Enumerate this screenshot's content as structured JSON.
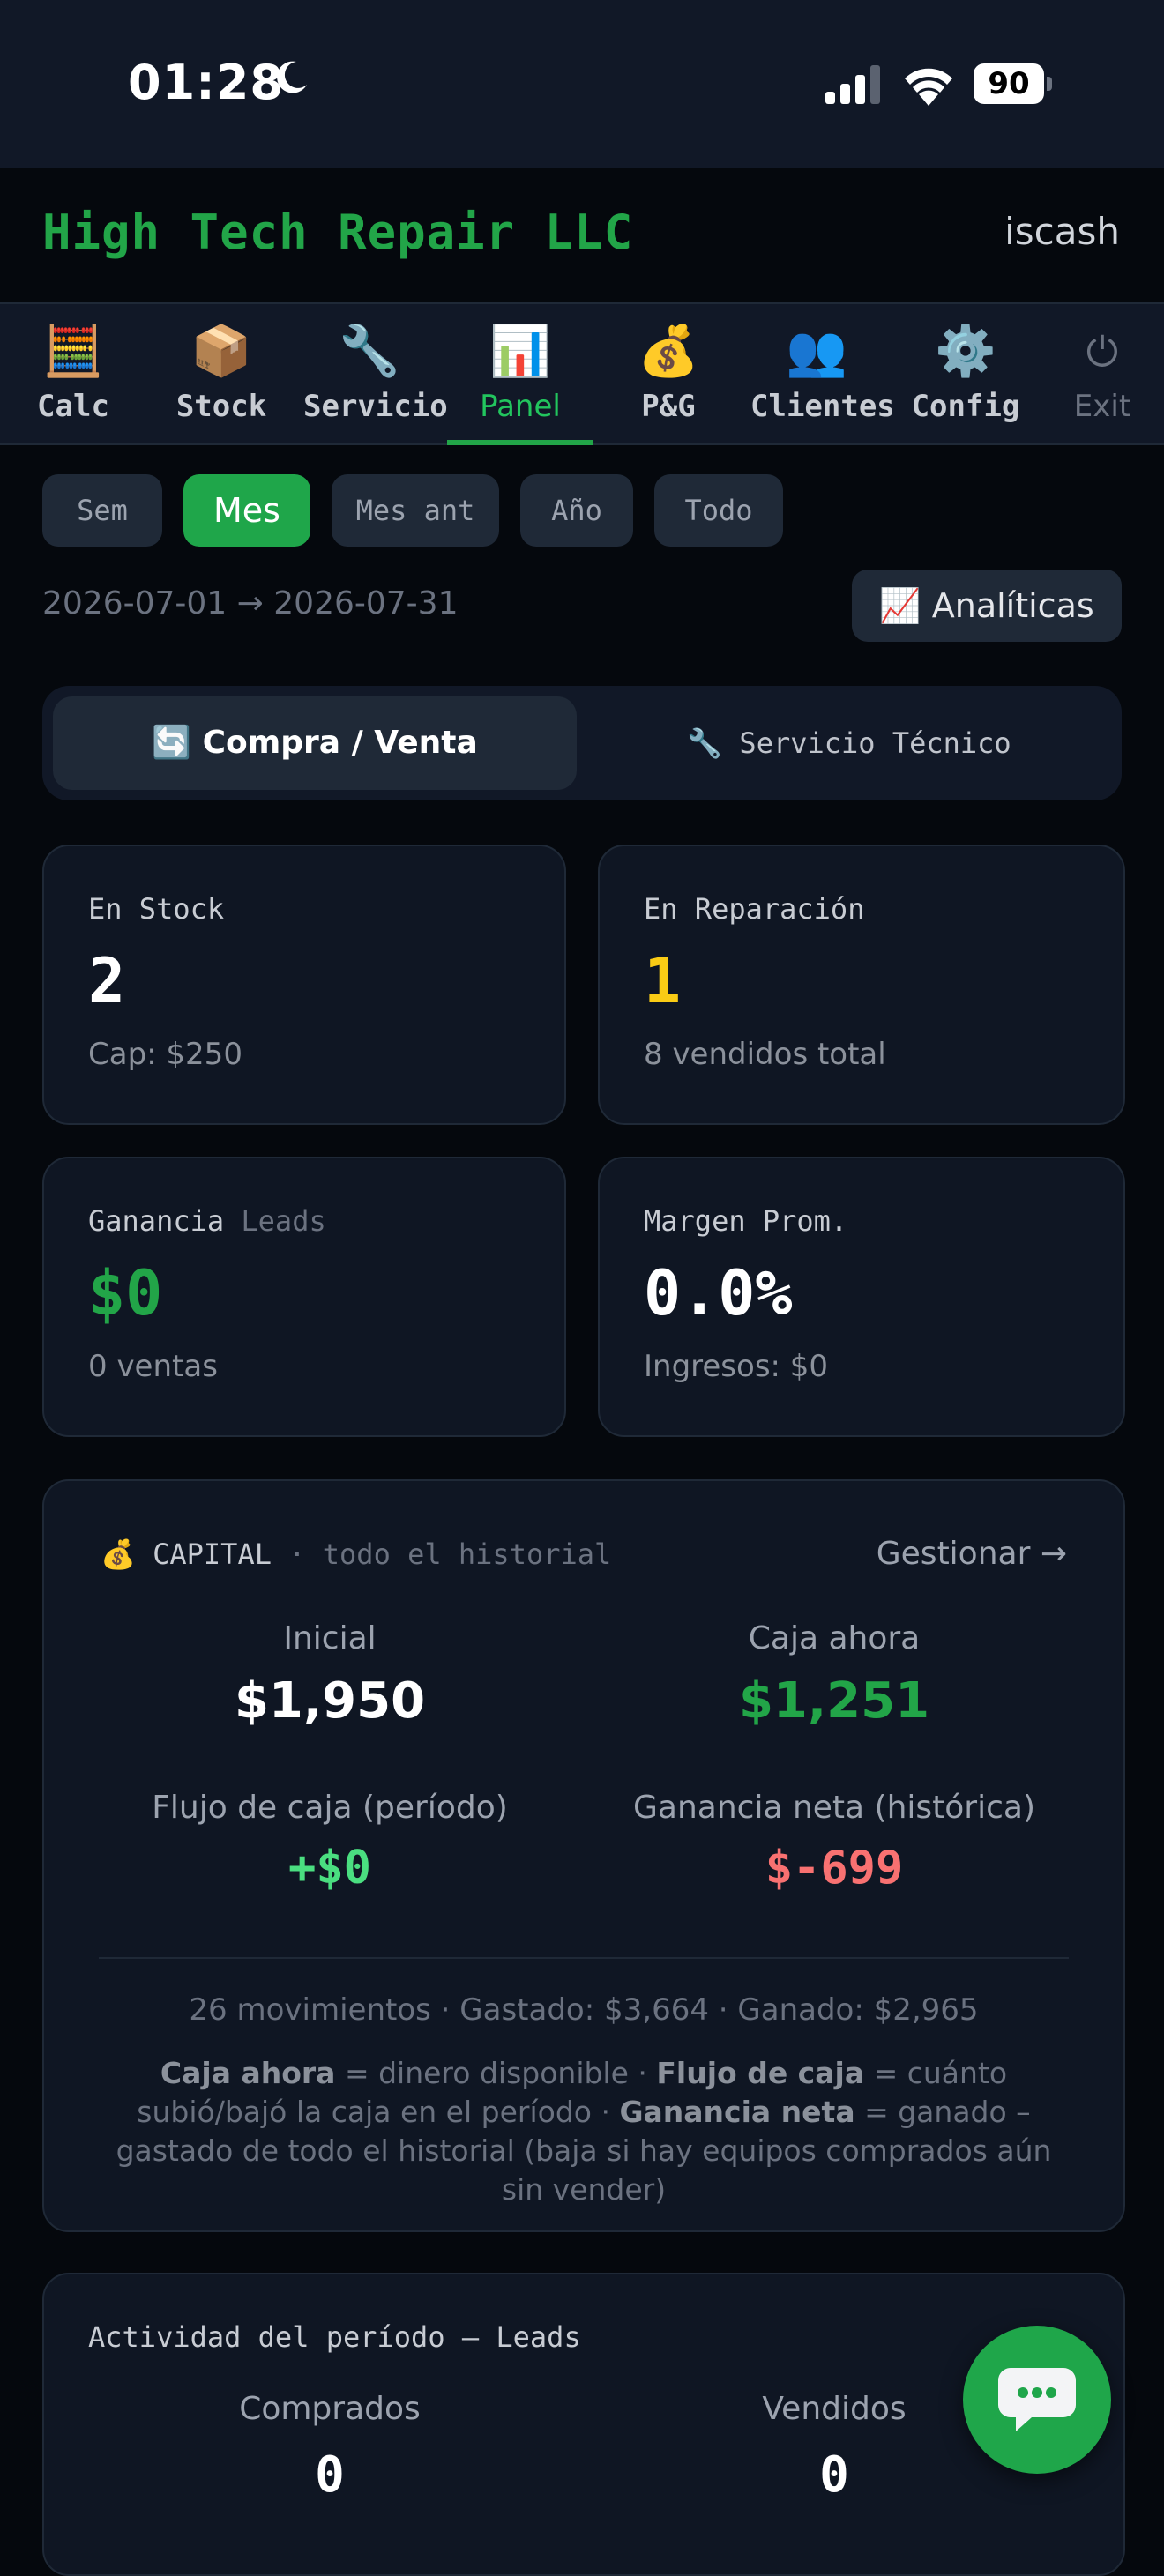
{
  "status": {
    "time": "01:28",
    "battery": "90"
  },
  "header": {
    "brand": "High Tech Repair LLC",
    "user": "iscash"
  },
  "nav": [
    {
      "icon": "🧮",
      "label": "Calc"
    },
    {
      "icon": "📦",
      "label": "Stock"
    },
    {
      "icon": "🔧",
      "label": "Servicio"
    },
    {
      "icon": "📊",
      "label": "Panel"
    },
    {
      "icon": "💰",
      "label": "P&G"
    },
    {
      "icon": "👥",
      "label": "Clientes"
    },
    {
      "icon": "⚙️",
      "label": "Config"
    },
    {
      "icon": "⏻",
      "label": "Exit"
    }
  ],
  "periods": [
    "Sem",
    "Mes",
    "Mes ant",
    "Año",
    "Todo"
  ],
  "range": "2026-07-01 → 2026-07-31",
  "analytics_label": "📈 Analíticas",
  "segment": {
    "left": "🔄 Compra / Venta",
    "right": "🔧 Servicio Técnico"
  },
  "cards": {
    "stock": {
      "label": "En Stock",
      "value": "2",
      "sub": "Cap: $250"
    },
    "repair": {
      "label": "En Reparación",
      "value": "1",
      "sub": "8 vendidos total"
    },
    "profit": {
      "label": "Ganancia",
      "label_tag": "Leads",
      "value": "$0",
      "sub": "0 ventas"
    },
    "margin": {
      "label": "Margen Prom.",
      "value": "0.0%",
      "sub": "Ingresos: $0"
    }
  },
  "capital": {
    "icon": "💰",
    "title": "CAPITAL",
    "subtitle": "· todo el historial",
    "manage": "Gestionar →",
    "initial_label": "Inicial",
    "initial_value": "$1,950",
    "cash_label": "Caja ahora",
    "cash_value": "$1,251",
    "flow_label": "Flujo de caja (período)",
    "flow_value": "+$0",
    "net_label": "Ganancia neta (histórica)",
    "net_value": "$-699",
    "summary": "26 movimientos · Gastado: $3,664 · Ganado: $2,965",
    "note": {
      "t1": "Caja ahora",
      "t2": " = dinero disponible · ",
      "t3": "Flujo de caja",
      "t4": " = cuánto subió/bajó la caja en el período · ",
      "t5": "Ganancia neta",
      "t6": " = ganado – gastado de todo el historial (baja si hay equipos comprados aún sin vender)"
    }
  },
  "activity": {
    "title": "Actividad del período — Leads",
    "bought_label": "Comprados",
    "bought_value": "0",
    "sold_label": "Vendidos",
    "sold_value": "0"
  },
  "colors": {
    "accent": "#22a548",
    "yellow": "#facc15",
    "red": "#f87171",
    "green_light": "#4ade80"
  }
}
